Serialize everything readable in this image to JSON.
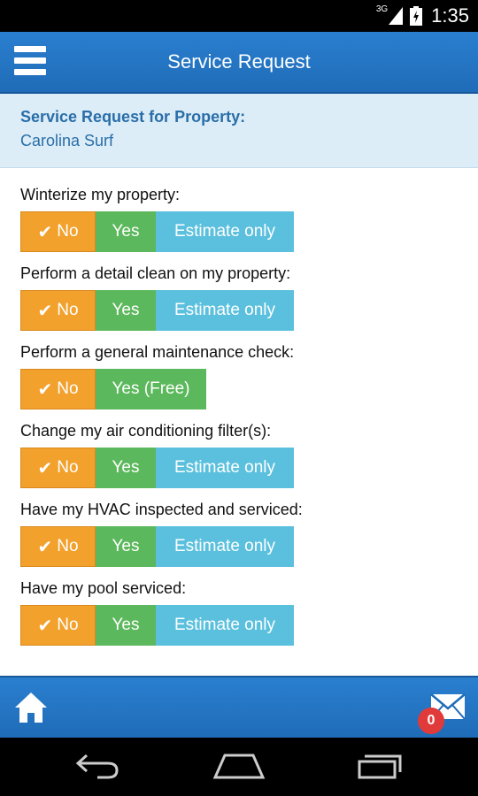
{
  "status_bar": {
    "network_label": "3G",
    "time": "1:35"
  },
  "app_bar": {
    "title": "Service Request"
  },
  "property": {
    "heading": "Service Request for Property:",
    "name": "Carolina Surf"
  },
  "questions": [
    {
      "label": "Winterize my property:",
      "options": [
        "No",
        "Yes",
        "Estimate only"
      ],
      "selected": "No"
    },
    {
      "label": "Perform a detail clean on my property:",
      "options": [
        "No",
        "Yes",
        "Estimate only"
      ],
      "selected": "No"
    },
    {
      "label": "Perform a general maintenance check:",
      "options": [
        "No",
        "Yes (Free)"
      ],
      "selected": "No"
    },
    {
      "label": "Change my air conditioning filter(s):",
      "options": [
        "No",
        "Yes",
        "Estimate only"
      ],
      "selected": "No"
    },
    {
      "label": "Have my HVAC inspected and serviced:",
      "options": [
        "No",
        "Yes",
        "Estimate only"
      ],
      "selected": "No"
    },
    {
      "label": "Have my pool serviced:",
      "options": [
        "No",
        "Yes",
        "Estimate only"
      ],
      "selected": "No"
    }
  ],
  "bottom_bar": {
    "mail_badge_count": "0",
    "icons": [
      "home-icon",
      "mail-icon"
    ]
  },
  "colors": {
    "app_bar": "#1f6cb8",
    "no_button": "#f2a12d",
    "yes_button": "#5cb85c",
    "estimate_button": "#5bc0de",
    "property_panel": "#dcedf8",
    "badge": "#e03a3a"
  }
}
